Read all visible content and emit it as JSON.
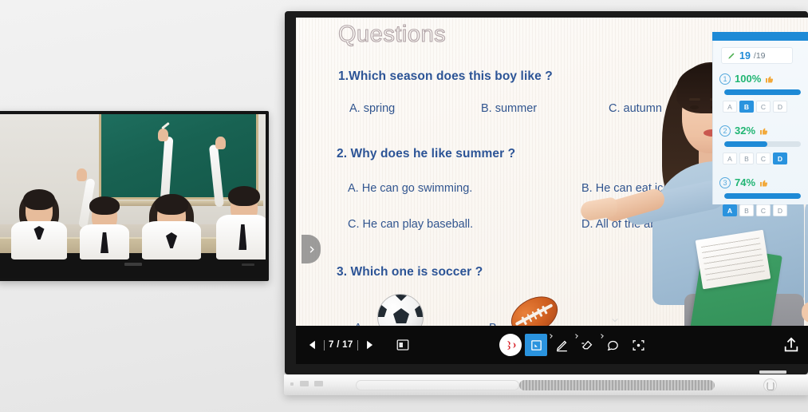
{
  "slide": {
    "title": "Questions",
    "questions": [
      {
        "text": "1.Which season does this boy like ?",
        "options": [
          "A. spring",
          "B. summer",
          "C. autumn"
        ]
      },
      {
        "text": "2. Why does he like summer ?",
        "options": [
          "A. He can go swimming.",
          "B. He can eat ice cream",
          "C. He can play baseball.",
          "D. All of the above"
        ]
      },
      {
        "text": "3. Which one is soccer ?",
        "options": [
          "A.",
          "B."
        ]
      }
    ],
    "annotation_tools": [
      "pen-icon",
      "curve-icon",
      "shape-icon",
      "eraser-icon",
      "cursor-icon",
      "record-icon"
    ]
  },
  "vote_panel": {
    "responded": "19",
    "total": "/19",
    "rows": [
      {
        "index": "1",
        "percent": "100%",
        "bar": 100,
        "options": [
          "A",
          "B",
          "C",
          "D"
        ],
        "selected": "B"
      },
      {
        "index": "2",
        "percent": "32%",
        "bar": 56,
        "options": [
          "A",
          "B",
          "C",
          "D"
        ],
        "selected": "D"
      },
      {
        "index": "3",
        "percent": "74%",
        "bar": 100,
        "options": [
          "A",
          "B",
          "C",
          "D"
        ],
        "selected": "A"
      }
    ]
  },
  "toolbar": {
    "prev_label": "previous-page",
    "next_label": "next-page",
    "page_indicator": "7 / 17",
    "ppt_label": "powerpoint",
    "tools": [
      {
        "name": "brand-logo-button",
        "label": "logo"
      },
      {
        "name": "select-tool-button",
        "label": "select",
        "active": true
      },
      {
        "name": "pen-tool-button",
        "label": "pen"
      },
      {
        "name": "eraser-tool-button",
        "label": "eraser"
      },
      {
        "name": "comment-tool-button",
        "label": "comment"
      },
      {
        "name": "screenshot-tool-button",
        "label": "screenshot"
      }
    ],
    "share_label": "share"
  },
  "collapse": {
    "sidebar_label": "expand-sidebar",
    "toolbar_label": "collapse-toolbar"
  },
  "photo": {
    "caption": "classroom students raising hands"
  },
  "colors": {
    "accent_blue": "#2a93de",
    "header_blue": "#1e8ad6",
    "percent_green": "#21b573",
    "thumb_orange": "#f2a93b",
    "question_blue": "#2c5496"
  }
}
